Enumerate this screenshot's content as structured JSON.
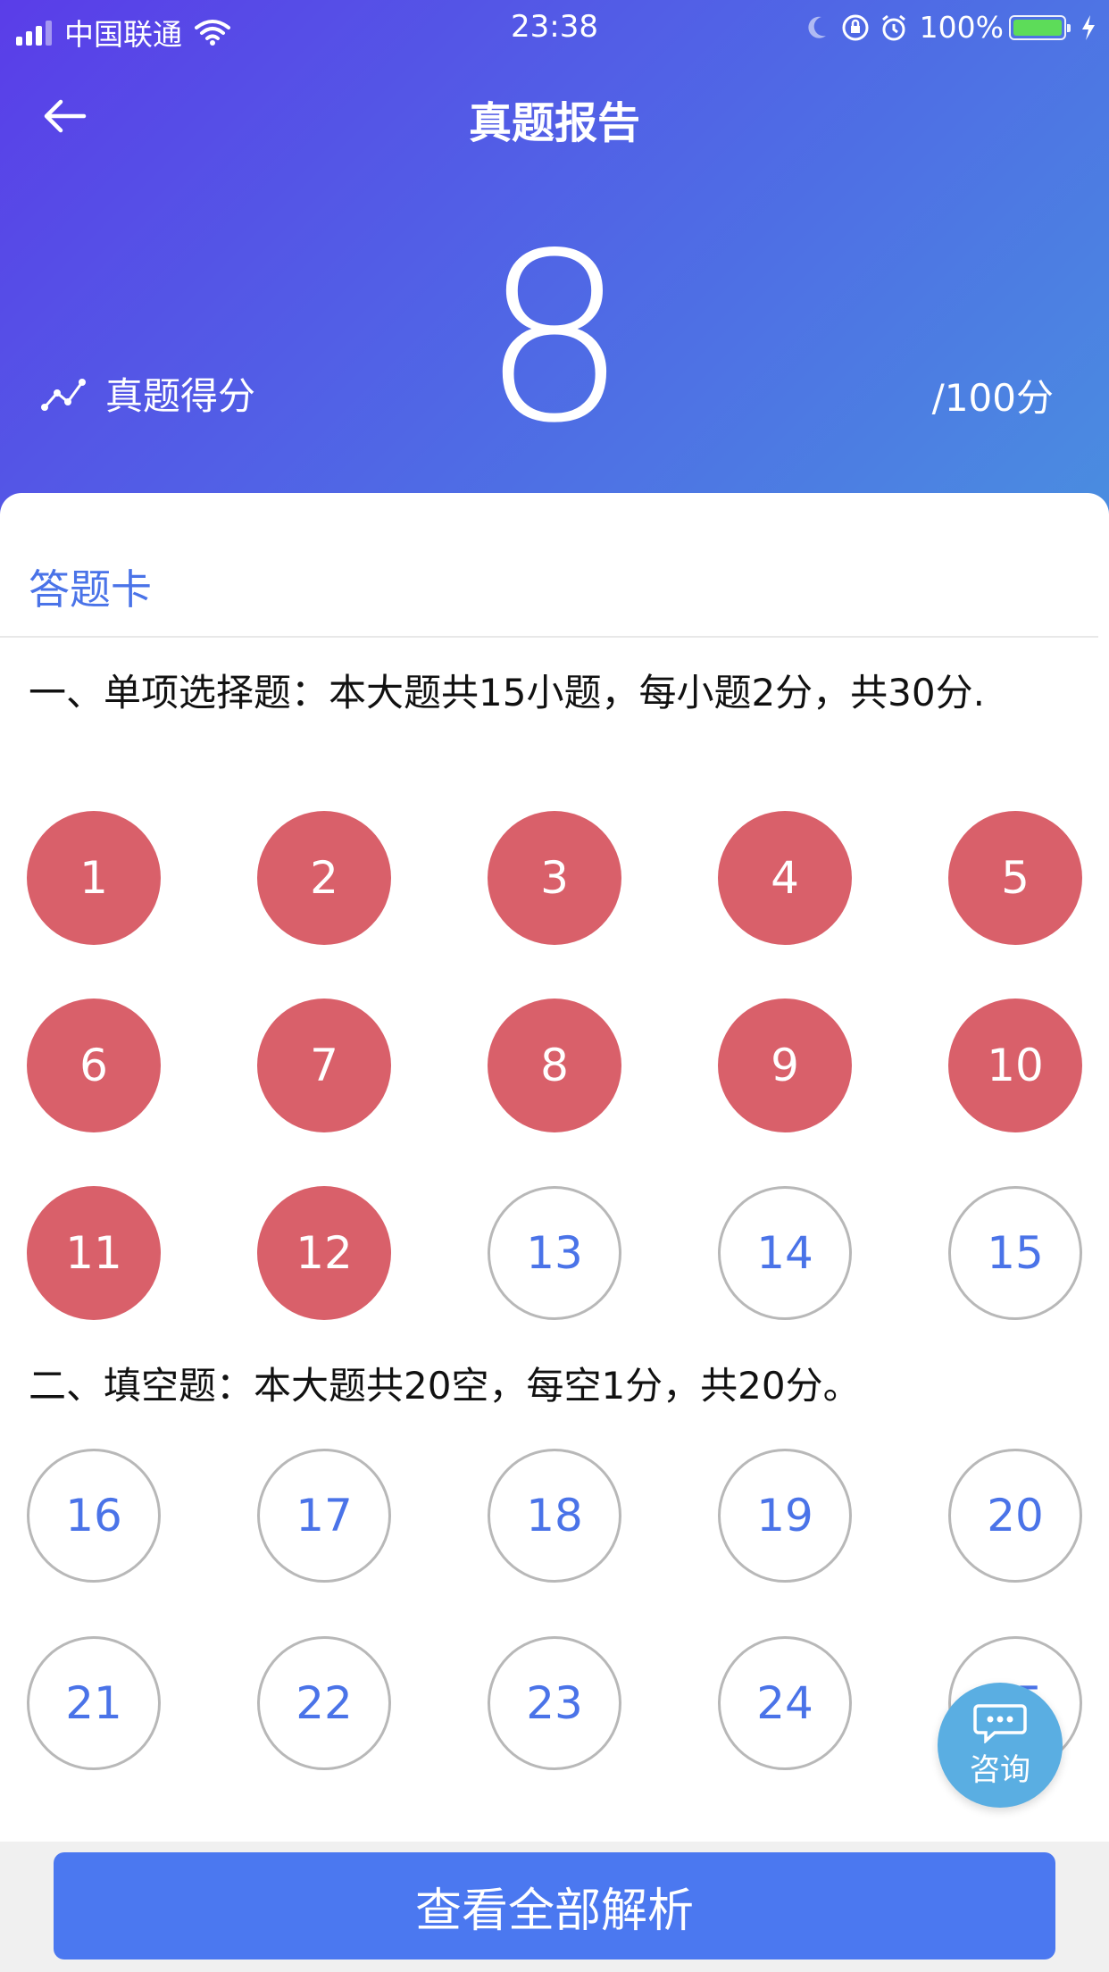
{
  "status_bar": {
    "carrier": "中国联通",
    "time": "23:38",
    "battery": "100%",
    "icons": [
      "signal-icon",
      "wifi-icon",
      "moon-icon",
      "rotation-lock-icon",
      "alarm-icon",
      "battery-icon",
      "charging-icon"
    ]
  },
  "nav": {
    "title": "真题报告",
    "back_icon": "back-arrow-icon"
  },
  "score": {
    "label": "真题得分",
    "value": "8",
    "total": "/100分",
    "icon": "trend-line-icon"
  },
  "answer_card": {
    "title": "答题卡",
    "sections": [
      {
        "title": "一、单项选择题：本大题共15小题，每小题2分，共30分.",
        "questions": [
          {
            "num": "1",
            "status": "wrong"
          },
          {
            "num": "2",
            "status": "wrong"
          },
          {
            "num": "3",
            "status": "wrong"
          },
          {
            "num": "4",
            "status": "wrong"
          },
          {
            "num": "5",
            "status": "wrong"
          },
          {
            "num": "6",
            "status": "wrong"
          },
          {
            "num": "7",
            "status": "wrong"
          },
          {
            "num": "8",
            "status": "wrong"
          },
          {
            "num": "9",
            "status": "wrong"
          },
          {
            "num": "10",
            "status": "wrong"
          },
          {
            "num": "11",
            "status": "wrong"
          },
          {
            "num": "12",
            "status": "wrong"
          },
          {
            "num": "13",
            "status": "unanswered"
          },
          {
            "num": "14",
            "status": "unanswered"
          },
          {
            "num": "15",
            "status": "unanswered"
          }
        ]
      },
      {
        "title": "二、填空题：本大题共20空，每空1分，共20分。",
        "questions": [
          {
            "num": "16",
            "status": "unanswered"
          },
          {
            "num": "17",
            "status": "unanswered"
          },
          {
            "num": "18",
            "status": "unanswered"
          },
          {
            "num": "19",
            "status": "unanswered"
          },
          {
            "num": "20",
            "status": "unanswered"
          },
          {
            "num": "21",
            "status": "unanswered"
          },
          {
            "num": "22",
            "status": "unanswered"
          },
          {
            "num": "23",
            "status": "unanswered"
          },
          {
            "num": "24",
            "status": "unanswered"
          },
          {
            "num": "25",
            "status": "unanswered"
          }
        ]
      }
    ]
  },
  "consult": {
    "label": "咨询",
    "icon": "chat-bubble-icon"
  },
  "bottom_button": {
    "label": "查看全部解析"
  },
  "colors": {
    "accent": "#4a73e8",
    "wrong": "#d9606a",
    "button": "#4b78f0",
    "consult": "#5aaee2"
  }
}
